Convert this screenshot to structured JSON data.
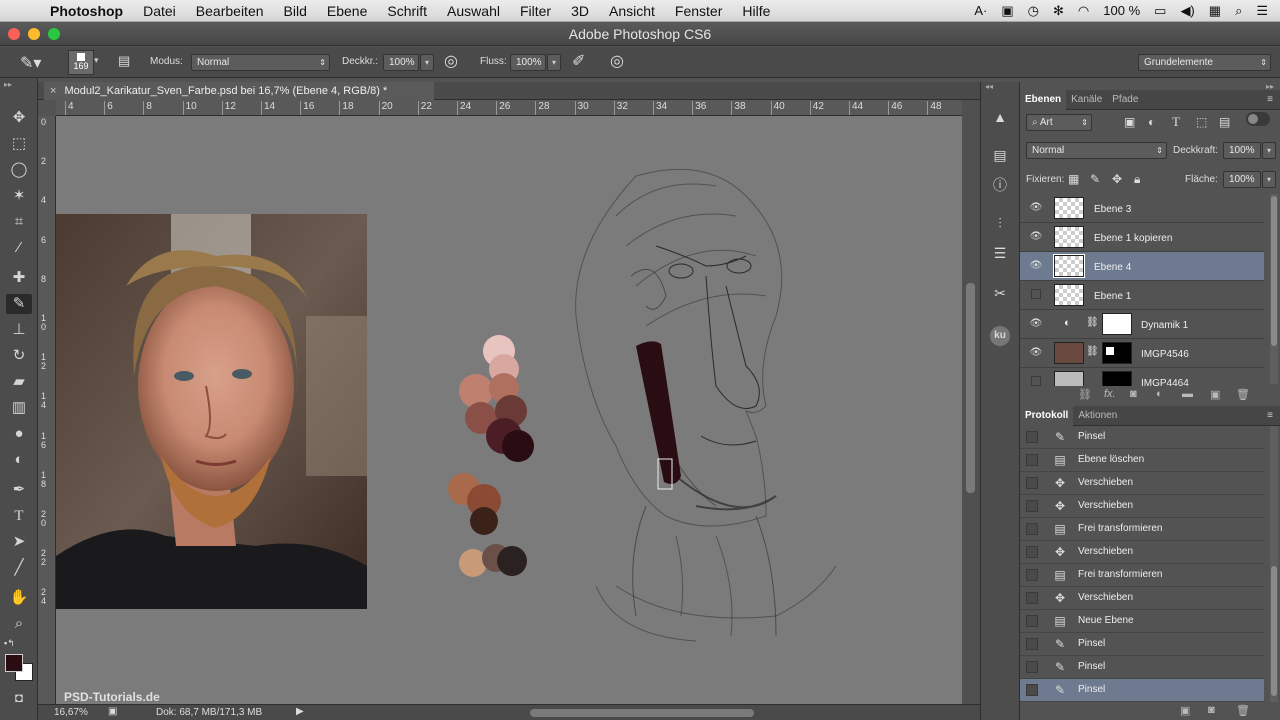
{
  "menubar": {
    "app": "Photoshop",
    "items": [
      "Datei",
      "Bearbeiten",
      "Bild",
      "Ebene",
      "Schrift",
      "Auswahl",
      "Filter",
      "3D",
      "Ansicht",
      "Fenster",
      "Hilfe"
    ],
    "battery": "100 %"
  },
  "window": {
    "title": "Adobe Photoshop CS6"
  },
  "options": {
    "brush_size": "169",
    "mode_label": "Modus:",
    "mode_value": "Normal",
    "opacity_label": "Deckkr.:",
    "opacity_value": "100%",
    "flow_label": "Fluss:",
    "flow_value": "100%",
    "workspace": "Grundelemente"
  },
  "document": {
    "tab_title": "Modul2_Karikatur_Sven_Farbe.psd bei 16,7% (Ebene 4, RGB/8) *",
    "ruler_h": [
      "4",
      "6",
      "8",
      "10",
      "12",
      "14",
      "16",
      "18",
      "20",
      "22",
      "24",
      "26",
      "28",
      "30",
      "32",
      "34",
      "36",
      "38",
      "40",
      "42",
      "44",
      "46",
      "48"
    ],
    "ruler_v": [
      "0",
      "2",
      "4",
      "6",
      "8",
      "1 0",
      "1 2",
      "1 4",
      "1 6",
      "1 8",
      "2 0",
      "2 2",
      "2 4"
    ]
  },
  "status": {
    "zoom": "16,67%",
    "doc": "Dok: 68,7 MB/171,3 MB"
  },
  "watermark": "PSD-Tutorials.de",
  "layers_panel": {
    "tabs": [
      "Ebenen",
      "Kanäle",
      "Pfade"
    ],
    "filter": "Art",
    "blend": "Normal",
    "opacity_label": "Deckkraft:",
    "opacity": "100%",
    "lock_label": "Fixieren:",
    "fill_label": "Fläche:",
    "fill": "100%",
    "layers": [
      {
        "name": "Ebene 3",
        "visible": true
      },
      {
        "name": "Ebene 1 kopieren",
        "visible": true
      },
      {
        "name": "Ebene 4",
        "visible": true,
        "selected": true
      },
      {
        "name": "Ebene 1",
        "visible": false
      },
      {
        "name": "Dynamik 1",
        "visible": true
      },
      {
        "name": "IMGP4546",
        "visible": true
      },
      {
        "name": "IMGP4464",
        "visible": false
      }
    ]
  },
  "history_panel": {
    "tabs": [
      "Protokoll",
      "Aktionen"
    ],
    "items": [
      {
        "icon": "brush-icon",
        "label": "Pinsel"
      },
      {
        "icon": "document-icon",
        "label": "Ebene löschen"
      },
      {
        "icon": "move-icon",
        "label": "Verschieben"
      },
      {
        "icon": "move-icon",
        "label": "Verschieben"
      },
      {
        "icon": "document-icon",
        "label": "Frei transformieren"
      },
      {
        "icon": "move-icon",
        "label": "Verschieben"
      },
      {
        "icon": "document-icon",
        "label": "Frei transformieren"
      },
      {
        "icon": "move-icon",
        "label": "Verschieben"
      },
      {
        "icon": "document-icon",
        "label": "Neue Ebene"
      },
      {
        "icon": "brush-icon",
        "label": "Pinsel"
      },
      {
        "icon": "brush-icon",
        "label": "Pinsel"
      },
      {
        "icon": "brush-icon",
        "label": "Pinsel",
        "selected": true
      }
    ]
  },
  "colors": {
    "foreground": "#2a0d12",
    "background": "#ffffff",
    "selection": "#6e7a8f"
  }
}
